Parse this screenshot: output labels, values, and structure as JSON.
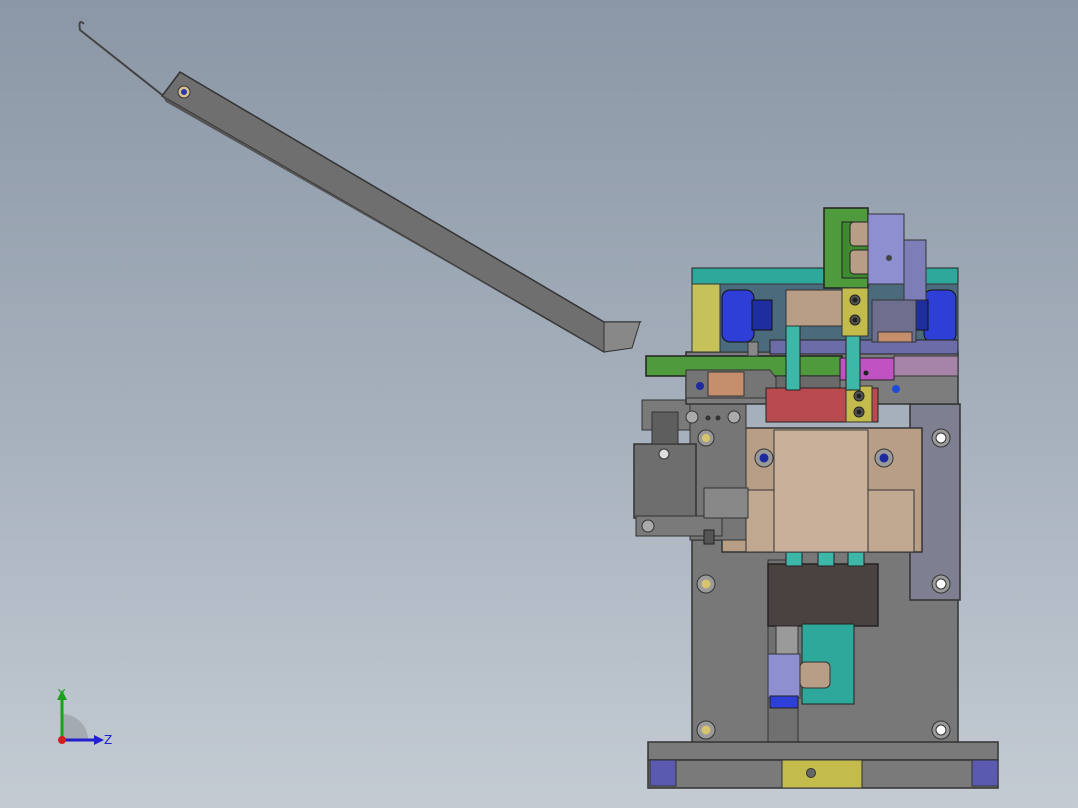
{
  "viewport": {
    "colors": {
      "background_top": "#8b97a6",
      "background_bottom": "#c4cbd3",
      "plate_gray": "#7a7a7a",
      "green": "#4e9a3c",
      "tan": "#b89e86",
      "blue": "#2d3fd6",
      "teal": "#2ea89b",
      "red": "#b94a4f",
      "magenta": "#c052c2",
      "lavender": "#8e8fd0",
      "yellow": "#d9d66a"
    }
  },
  "triad": {
    "y_label": "Y",
    "z_label": "Z",
    "y_color": "#1aa31a",
    "z_color": "#2020d0",
    "x_color": "#d02020"
  }
}
